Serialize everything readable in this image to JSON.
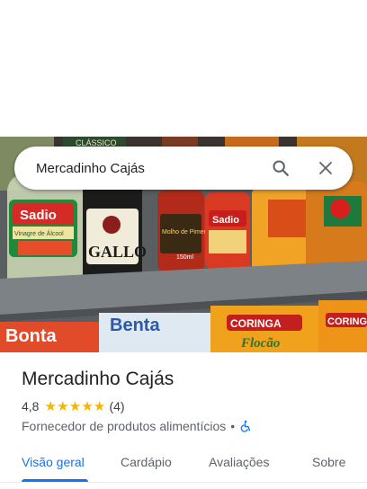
{
  "search": {
    "query": "Mercadinho Cajás",
    "search_icon": "search-icon",
    "close_icon": "close-icon"
  },
  "hero": {
    "shelf_labels": {
      "top_bottle": "CLÁSSICO",
      "sadio_brand": "Sadio",
      "sadio_sub": "Vinagre de Álcool",
      "gallo": "GALLO",
      "molho": "Molho de Pimenta",
      "molho_size": "150ml",
      "sadio2": "Sadio",
      "bag1": "Bonta",
      "bag2": "Benta",
      "coringa": "CORINGA",
      "flocao": "Flocão",
      "coringa2": "CORING"
    }
  },
  "place": {
    "name": "Mercadinho Cajás",
    "rating": "4,8",
    "stars": 5,
    "review_count": "(4)",
    "category": "Fornecedor de produtos alimentícios",
    "separator": "•",
    "accessibility_icon": "wheelchair-icon"
  },
  "tabs": [
    {
      "label": "Visão geral",
      "active": true
    },
    {
      "label": "Cardápio",
      "active": false
    },
    {
      "label": "Avaliações",
      "active": false
    },
    {
      "label": "Sobre",
      "active": false
    }
  ],
  "colors": {
    "accent": "#1a73e8",
    "star": "#f5b400"
  }
}
